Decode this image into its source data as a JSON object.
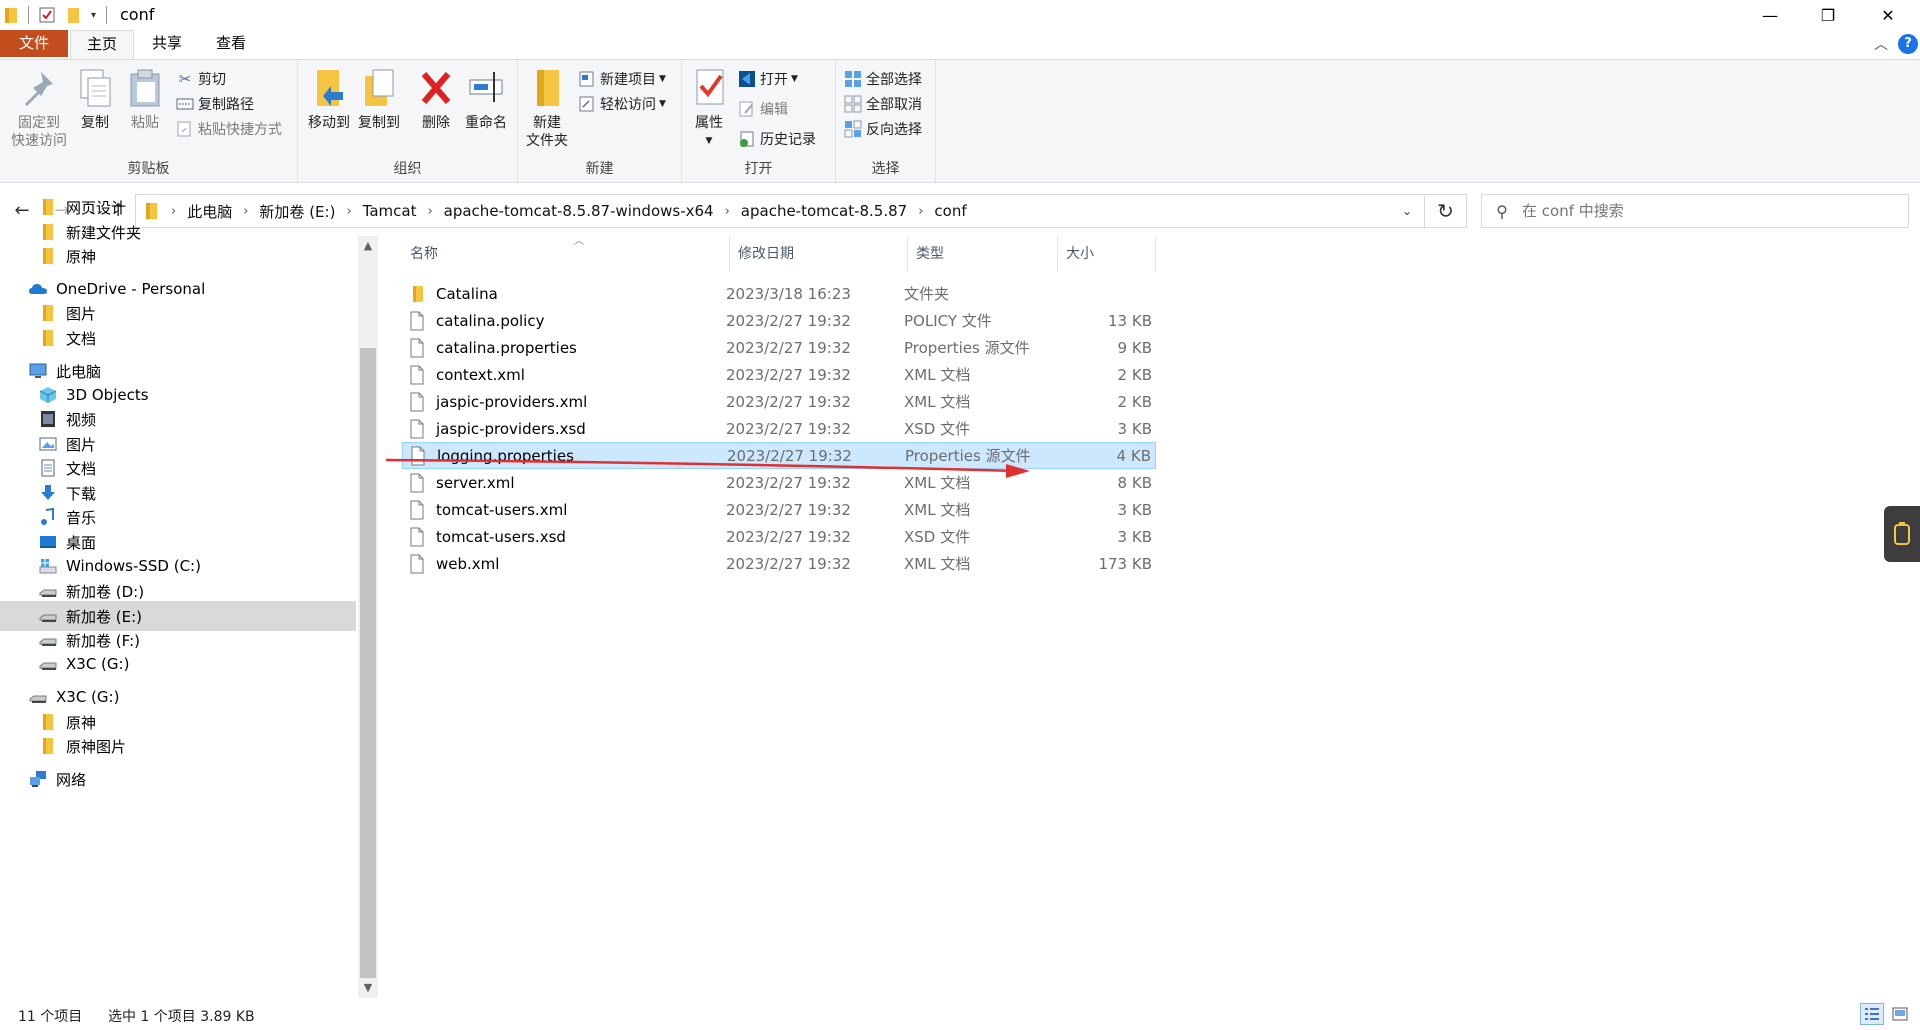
{
  "window": {
    "title": "conf",
    "controls": {
      "minimize": "—",
      "maximize": "❐",
      "close": "✕"
    }
  },
  "ribbon_tabs": [
    "文件",
    "主页",
    "共享",
    "查看"
  ],
  "ribbon": {
    "clipboard": {
      "label": "剪贴板",
      "pin_line1": "固定到",
      "pin_line2": "快速访问",
      "copy": "复制",
      "paste": "粘贴",
      "cut": "剪切",
      "copy_path": "复制路径",
      "paste_shortcut": "粘贴快捷方式"
    },
    "organize": {
      "label": "组织",
      "move_to": "移动到",
      "copy_to": "复制到",
      "delete": "删除",
      "rename": "重命名"
    },
    "new": {
      "label": "新建",
      "new_folder_line1": "新建",
      "new_folder_line2": "文件夹",
      "new_item": "新建项目",
      "easy_access": "轻松访问"
    },
    "open": {
      "label": "打开",
      "properties": "属性",
      "open": "打开",
      "edit": "编辑",
      "history": "历史记录"
    },
    "select": {
      "label": "选择",
      "select_all": "全部选择",
      "select_none": "全部取消",
      "invert": "反向选择"
    }
  },
  "address": {
    "breadcrumbs": [
      "此电脑",
      "新加卷 (E:)",
      "Tamcat",
      "apache-tomcat-8.5.87-windows-x64",
      "apache-tomcat-8.5.87",
      "conf"
    ],
    "search_placeholder": "在 conf 中搜索"
  },
  "nav_pane": {
    "items": [
      {
        "label": "网页设计",
        "icon": "folder-icon"
      },
      {
        "label": "新建文件夹",
        "icon": "folder-icon"
      },
      {
        "label": "原神",
        "icon": "folder-icon"
      },
      {
        "label": "OneDrive - Personal",
        "icon": "cloud-icon"
      },
      {
        "label": "图片",
        "icon": "folder-icon"
      },
      {
        "label": "文档",
        "icon": "folder-icon"
      },
      {
        "label": "此电脑",
        "icon": "computer-icon"
      },
      {
        "label": "3D Objects",
        "icon": "cube-icon"
      },
      {
        "label": "视频",
        "icon": "video-icon"
      },
      {
        "label": "图片",
        "icon": "pictures-icon"
      },
      {
        "label": "文档",
        "icon": "documents-icon"
      },
      {
        "label": "下载",
        "icon": "download-icon"
      },
      {
        "label": "音乐",
        "icon": "music-icon"
      },
      {
        "label": "桌面",
        "icon": "desktop-icon"
      },
      {
        "label": "Windows-SSD (C:)",
        "icon": "windows-drive-icon"
      },
      {
        "label": "新加卷 (D:)",
        "icon": "drive-icon"
      },
      {
        "label": "新加卷 (E:)",
        "icon": "drive-icon"
      },
      {
        "label": "新加卷 (F:)",
        "icon": "drive-icon"
      },
      {
        "label": "X3C (G:)",
        "icon": "drive-icon"
      },
      {
        "label": "X3C (G:)",
        "icon": "drive-icon"
      },
      {
        "label": "原神",
        "icon": "folder-icon"
      },
      {
        "label": "原神图片",
        "icon": "folder-icon"
      },
      {
        "label": "网络",
        "icon": "network-icon"
      }
    ]
  },
  "file_list": {
    "columns": [
      "名称",
      "修改日期",
      "类型",
      "大小"
    ],
    "rows": [
      {
        "name": "Catalina",
        "date": "2023/3/18 16:23",
        "type": "文件夹",
        "size": "",
        "icon": "folder-icon"
      },
      {
        "name": "catalina.policy",
        "date": "2023/2/27 19:32",
        "type": "POLICY 文件",
        "size": "13 KB",
        "icon": "file-icon"
      },
      {
        "name": "catalina.properties",
        "date": "2023/2/27 19:32",
        "type": "Properties 源文件",
        "size": "9 KB",
        "icon": "file-icon"
      },
      {
        "name": "context.xml",
        "date": "2023/2/27 19:32",
        "type": "XML 文档",
        "size": "2 KB",
        "icon": "file-icon"
      },
      {
        "name": "jaspic-providers.xml",
        "date": "2023/2/27 19:32",
        "type": "XML 文档",
        "size": "2 KB",
        "icon": "file-icon"
      },
      {
        "name": "jaspic-providers.xsd",
        "date": "2023/2/27 19:32",
        "type": "XSD 文件",
        "size": "3 KB",
        "icon": "file-icon"
      },
      {
        "name": "logging.properties",
        "date": "2023/2/27 19:32",
        "type": "Properties 源文件",
        "size": "4 KB",
        "icon": "file-icon"
      },
      {
        "name": "server.xml",
        "date": "2023/2/27 19:32",
        "type": "XML 文档",
        "size": "8 KB",
        "icon": "file-icon"
      },
      {
        "name": "tomcat-users.xml",
        "date": "2023/2/27 19:32",
        "type": "XML 文档",
        "size": "3 KB",
        "icon": "file-icon"
      },
      {
        "name": "tomcat-users.xsd",
        "date": "2023/2/27 19:32",
        "type": "XSD 文件",
        "size": "3 KB",
        "icon": "file-icon"
      },
      {
        "name": "web.xml",
        "date": "2023/2/27 19:32",
        "type": "XML 文档",
        "size": "173 KB",
        "icon": "file-icon"
      }
    ],
    "selected_row": "logging.properties"
  },
  "status": {
    "item_count": "11 个项目",
    "selection": "选中 1 个项目  3.89 KB"
  },
  "colors": {
    "file_tab": "#c34e1d",
    "selection_bg": "#cce8ff",
    "selection_border": "#99d1ff",
    "annotation_arrow": "#e03030",
    "folder": "#f5c541"
  }
}
